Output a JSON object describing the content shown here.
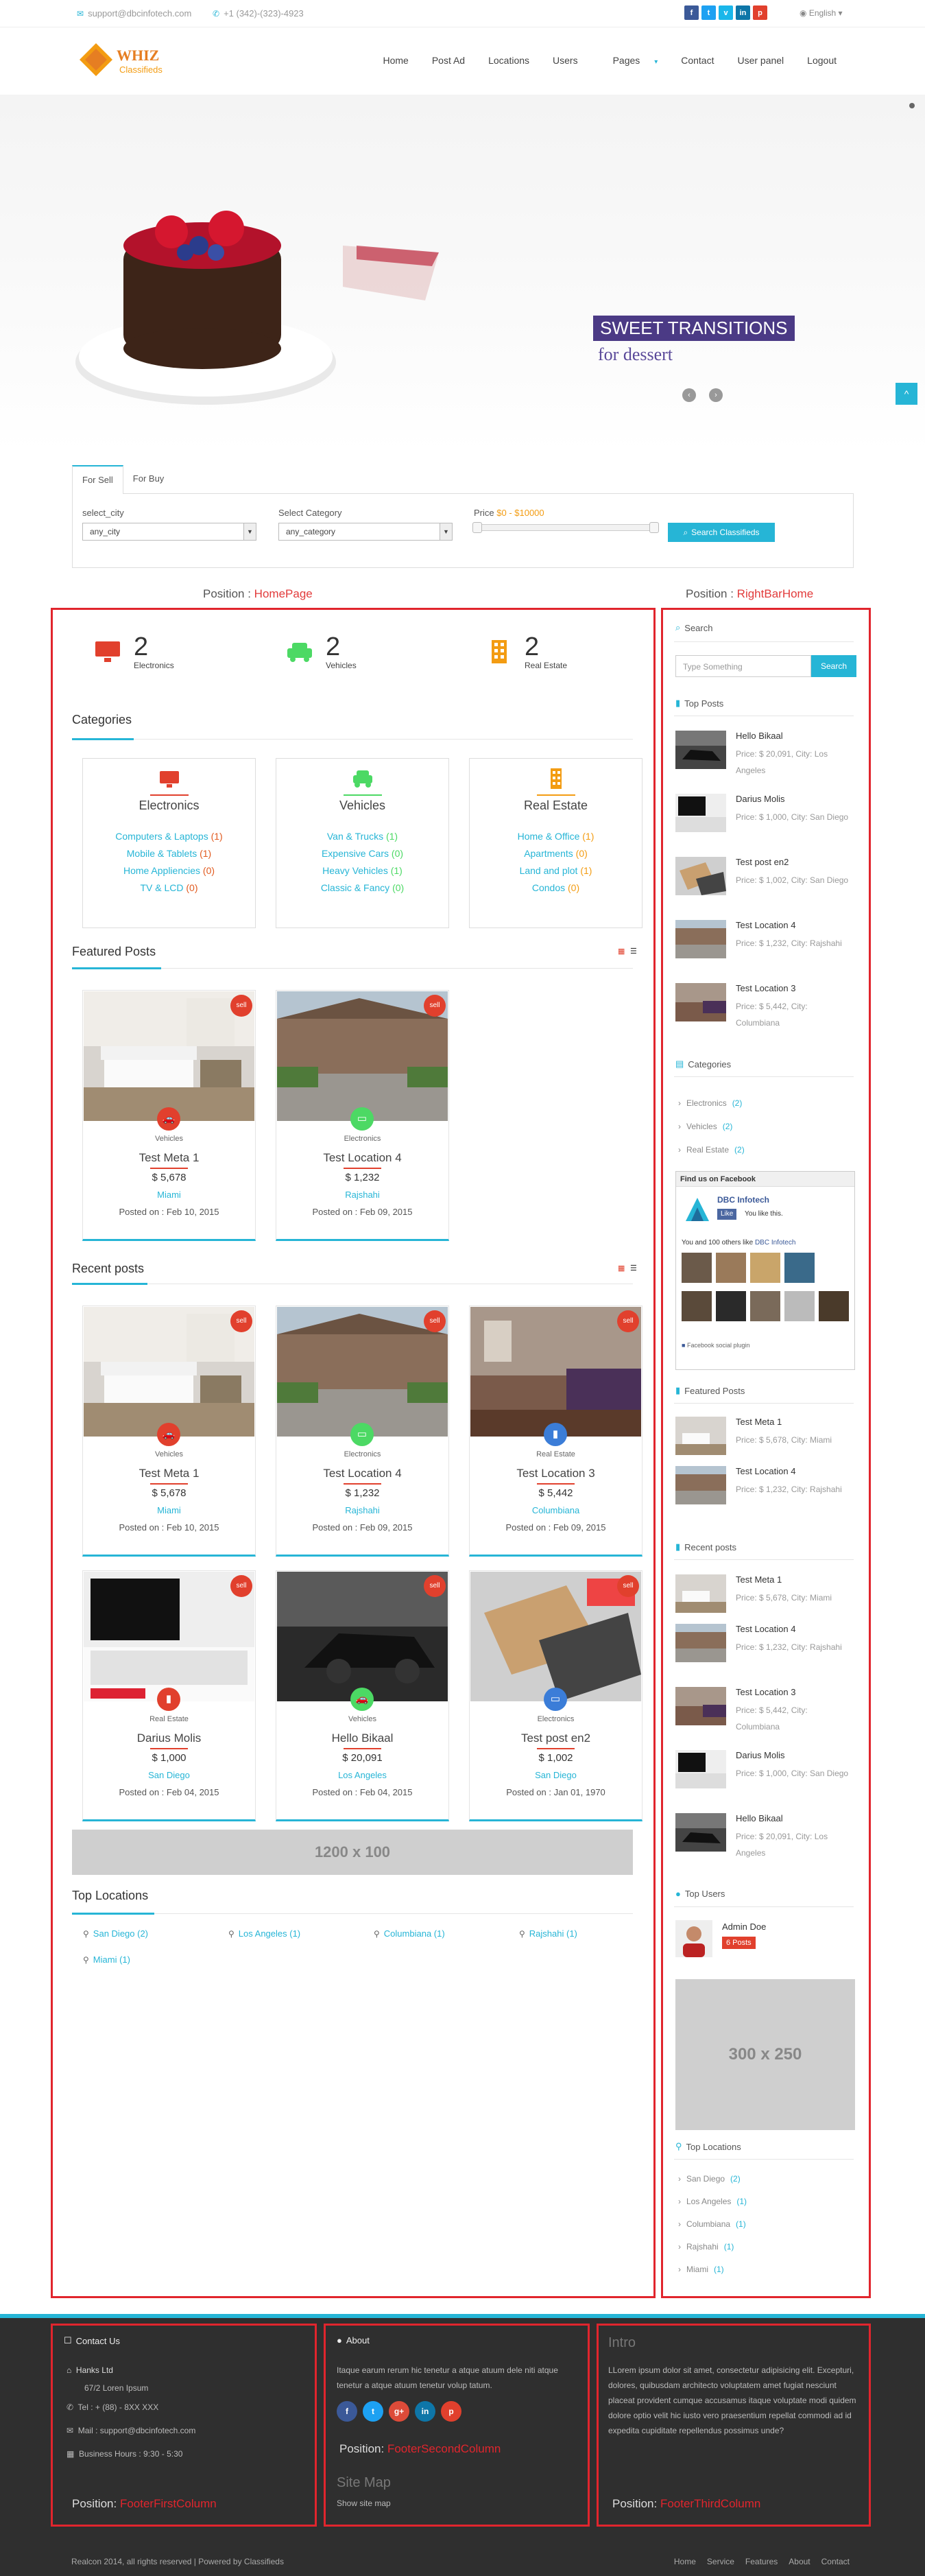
{
  "topbar": {
    "email": "support@dbcinfotech.com",
    "phone": "+1 (342)-(323)-4923",
    "social": [
      "f",
      "t",
      "v",
      "in",
      "p"
    ],
    "language": "English"
  },
  "header": {
    "logo_name": "WHIZ",
    "logo_sub": "Classifieds",
    "nav": [
      "Home",
      "Post Ad",
      "Locations",
      "Users",
      "Pages",
      "Contact",
      "User panel",
      "Logout"
    ]
  },
  "slider": {
    "headline": "SWEET TRANSITIONS",
    "subline": "for dessert"
  },
  "search": {
    "tabs": [
      "For Sell",
      "For Buy"
    ],
    "city_label": "select_city",
    "city_value": "any_city",
    "category_label": "Select Category",
    "category_value": "any_category",
    "price_label": "Price",
    "price_range": "$0 - $10000",
    "button": "Search Classifieds"
  },
  "positions": {
    "prefix": "Position :",
    "home": "HomePage",
    "right": "RightBarHome"
  },
  "stats": [
    {
      "num": "2",
      "label": "Electronics"
    },
    {
      "num": "2",
      "label": "Vehicles"
    },
    {
      "num": "2",
      "label": "Real Estate"
    }
  ],
  "categories_title": "Categories",
  "categories": [
    {
      "name": "Electronics",
      "items": [
        {
          "t": "Computers & Laptops",
          "c": "(1)"
        },
        {
          "t": "Mobile & Tablets",
          "c": "(1)"
        },
        {
          "t": "Home Appliencies",
          "c": "(0)"
        },
        {
          "t": "TV & LCD",
          "c": "(0)"
        }
      ]
    },
    {
      "name": "Vehicles",
      "items": [
        {
          "t": "Van & Trucks",
          "c": "(1)"
        },
        {
          "t": "Expensive Cars",
          "c": "(0)"
        },
        {
          "t": "Heavy Vehicles",
          "c": "(1)"
        },
        {
          "t": "Classic & Fancy",
          "c": "(0)"
        }
      ]
    },
    {
      "name": "Real Estate",
      "items": [
        {
          "t": "Home & Office",
          "c": "(1)"
        },
        {
          "t": "Apartments",
          "c": "(0)"
        },
        {
          "t": "Land and plot",
          "c": "(1)"
        },
        {
          "t": "Condos",
          "c": "(0)"
        }
      ]
    }
  ],
  "featured_title": "Featured Posts",
  "recent_title": "Recent posts",
  "sell_badge": "sell",
  "posts": {
    "f1": {
      "cat": "Vehicles",
      "title": "Test Meta 1",
      "price": "$ 5,678",
      "city": "Miami",
      "posted": "Posted on : Feb 10, 2015"
    },
    "f2": {
      "cat": "Electronics",
      "title": "Test Location 4",
      "price": "$ 1,232",
      "city": "Rajshahi",
      "posted": "Posted on : Feb 09, 2015"
    },
    "r3": {
      "cat": "Real Estate",
      "title": "Test Location 3",
      "price": "$ 5,442",
      "city": "Columbiana",
      "posted": "Posted on : Feb 09, 2015"
    },
    "r4": {
      "cat": "Real Estate",
      "title": "Darius Molis",
      "price": "$ 1,000",
      "city": "San Diego",
      "posted": "Posted on : Feb 04, 2015"
    },
    "r5": {
      "cat": "Vehicles",
      "title": "Hello Bikaal",
      "price": "$ 20,091",
      "city": "Los Angeles",
      "posted": "Posted on : Feb 04, 2015"
    },
    "r6": {
      "cat": "Electronics",
      "title": "Test post en2",
      "price": "$ 1,002",
      "city": "San Diego",
      "posted": "Posted on : Jan 01, 1970"
    }
  },
  "banner": "1200 x 100",
  "top_locations_title": "Top Locations",
  "top_locations": [
    "San Diego (2)",
    "Los Angeles (1)",
    "Columbiana (1)",
    "Rajshahi (1)",
    "Miami (1)"
  ],
  "sidebar": {
    "search_title": "Search",
    "search_placeholder": "Type Something",
    "search_button": "Search",
    "top_posts_title": "Top Posts",
    "top_posts": [
      {
        "t": "Hello Bikaal",
        "d": "Price: $ 20,091, City: Los Angeles"
      },
      {
        "t": "Darius Molis",
        "d": "Price: $ 1,000, City: San Diego"
      },
      {
        "t": "Test post en2",
        "d": "Price: $ 1,002, City: San Diego"
      },
      {
        "t": "Test Location 4",
        "d": "Price: $ 1,232, City: Rajshahi"
      },
      {
        "t": "Test Location 3",
        "d": "Price: $ 5,442, City: Columbiana"
      }
    ],
    "categories_title": "Categories",
    "categories": [
      {
        "t": "Electronics",
        "c": "(2)"
      },
      {
        "t": "Vehicles",
        "c": "(2)"
      },
      {
        "t": "Real Estate",
        "c": "(2)"
      }
    ],
    "fb_title": "Find us on Facebook",
    "fb_page": "DBC Infotech",
    "fb_like": "Like",
    "fb_likes_this": "You like this.",
    "fb_others": "You and 100 others like",
    "fb_plugin": "Facebook social plugin",
    "featured_title": "Featured Posts",
    "featured": [
      {
        "t": "Test Meta 1",
        "d": "Price: $ 5,678, City: Miami"
      },
      {
        "t": "Test Location 4",
        "d": "Price: $ 1,232, City: Rajshahi"
      }
    ],
    "recent_title": "Recent posts",
    "recent": [
      {
        "t": "Test Meta 1",
        "d": "Price: $ 5,678, City: Miami"
      },
      {
        "t": "Test Location 4",
        "d": "Price: $ 1,232, City: Rajshahi"
      },
      {
        "t": "Test Location 3",
        "d": "Price: $ 5,442, City: Columbiana"
      },
      {
        "t": "Darius Molis",
        "d": "Price: $ 1,000, City: San Diego"
      },
      {
        "t": "Hello Bikaal",
        "d": "Price: $ 20,091, City: Los Angeles"
      }
    ],
    "top_users_title": "Top Users",
    "user_name": "Admin Doe",
    "user_posts": "6 Posts",
    "ad": "300 x 250",
    "top_locations_title": "Top Locations",
    "top_locations": [
      {
        "t": "San Diego",
        "c": "(2)"
      },
      {
        "t": "Los Angeles",
        "c": "(1)"
      },
      {
        "t": "Columbiana",
        "c": "(1)"
      },
      {
        "t": "Rajshahi",
        "c": "(1)"
      },
      {
        "t": "Miami",
        "c": "(1)"
      }
    ]
  },
  "footer": {
    "contact_title": "Contact Us",
    "company": "Hanks Ltd",
    "address": "67/2 Loren Ipsum",
    "tel": "Tel : + (88) - 8XX XXX",
    "mail": "Mail : support@dbcinfotech.com",
    "hours": "Business Hours : 9:30 - 5:30",
    "about_title": "About",
    "about_text": "Itaque earum rerum hic tenetur a atque atuum dele niti atque tenetur a atque atuum tenetur volup tatum.",
    "sitemap_title": "Site Map",
    "sitemap_link": "Show site map",
    "intro_title": "Intro",
    "intro_text": "LLorem ipsum dolor sit amet, consectetur adipisicing elit. Excepturi, dolores, quibusdam architecto voluptatem amet fugiat nesciunt placeat provident cumque accusamus itaque voluptate modi quidem dolore optio velit hic iusto vero praesentium repellat commodi ad id expedita cupiditate repellendus possimus unde?",
    "pos_prefix": "Position:",
    "pos1": "FooterFirstColumn",
    "pos2": "FooterSecondColumn",
    "pos3": "FooterThirdColumn",
    "copyright": "Realcon 2014, all rights reserved | Powered by Classifieds",
    "links": [
      "Home",
      "Service",
      "Features",
      "About",
      "Contact"
    ]
  },
  "colors": {
    "accent": "#26b5d6",
    "red": "#e1252d",
    "orange": "#f39c12",
    "green": "#4cd964",
    "blue": "#3b7dd8"
  }
}
